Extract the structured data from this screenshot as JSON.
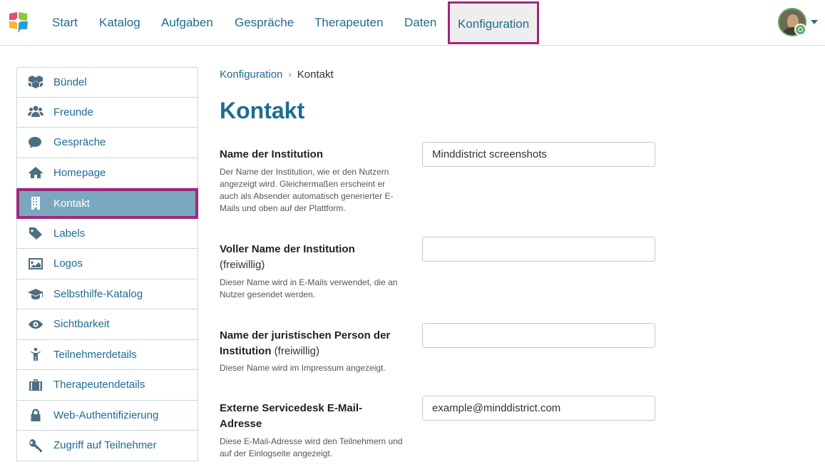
{
  "nav": {
    "items": [
      {
        "label": "Start"
      },
      {
        "label": "Katalog"
      },
      {
        "label": "Aufgaben"
      },
      {
        "label": "Gespräche"
      },
      {
        "label": "Therapeuten"
      },
      {
        "label": "Daten"
      },
      {
        "label": "Konfiguration",
        "active": true
      }
    ]
  },
  "sidebar": {
    "items": [
      {
        "label": "Bündel",
        "icon": "cubes-icon"
      },
      {
        "label": "Freunde",
        "icon": "users-icon"
      },
      {
        "label": "Gespräche",
        "icon": "comments-icon"
      },
      {
        "label": "Homepage",
        "icon": "home-icon"
      },
      {
        "label": "Kontakt",
        "icon": "building-icon",
        "active": true
      },
      {
        "label": "Labels",
        "icon": "tag-icon"
      },
      {
        "label": "Logos",
        "icon": "image-icon"
      },
      {
        "label": "Selbsthilfe-Katalog",
        "icon": "graduation-cap-icon"
      },
      {
        "label": "Sichtbarkeit",
        "icon": "eye-icon"
      },
      {
        "label": "Teilnehmerdetails",
        "icon": "person-icon"
      },
      {
        "label": "Therapeutendetails",
        "icon": "briefcase-icon"
      },
      {
        "label": "Web-Authentifizierung",
        "icon": "lock-icon"
      },
      {
        "label": "Zugriff auf Teilnehmer",
        "icon": "key-icon"
      }
    ]
  },
  "breadcrumb": {
    "parent": "Konfiguration",
    "separator": "›",
    "current": "Kontakt"
  },
  "page": {
    "title": "Kontakt"
  },
  "fields": [
    {
      "label": "Name der Institution",
      "optional": "",
      "help": "Der Name der Institution, wie er den Nutzern angezeigt wird. Gleichermaßen erscheint er auch als Absender automatisch generierter E-Mails und oben auf der Plattform.",
      "value": "Minddistrict screenshots"
    },
    {
      "label": "Voller Name der Institution",
      "optional": "(freiwillig)",
      "help": "Dieser Name wird in E-Mails verwendet, die an Nutzer gesendet werden.",
      "value": ""
    },
    {
      "label": "Name der juristischen Person der Institution",
      "optional": "(freiwillig)",
      "help": "Dieser Name wird im Impressum angezeigt.",
      "value": ""
    },
    {
      "label": "Externe Servicedesk E-Mail-Adresse",
      "optional": "",
      "help": "Diese E-Mail-Adresse wird den Teilnehmern und auf der Einlogseite angezeigt.",
      "value": "example@minddistrict.com"
    }
  ],
  "colors": {
    "brand": "#1f6b91",
    "highlight": "#a0277f",
    "active_bg": "#79a8be"
  }
}
